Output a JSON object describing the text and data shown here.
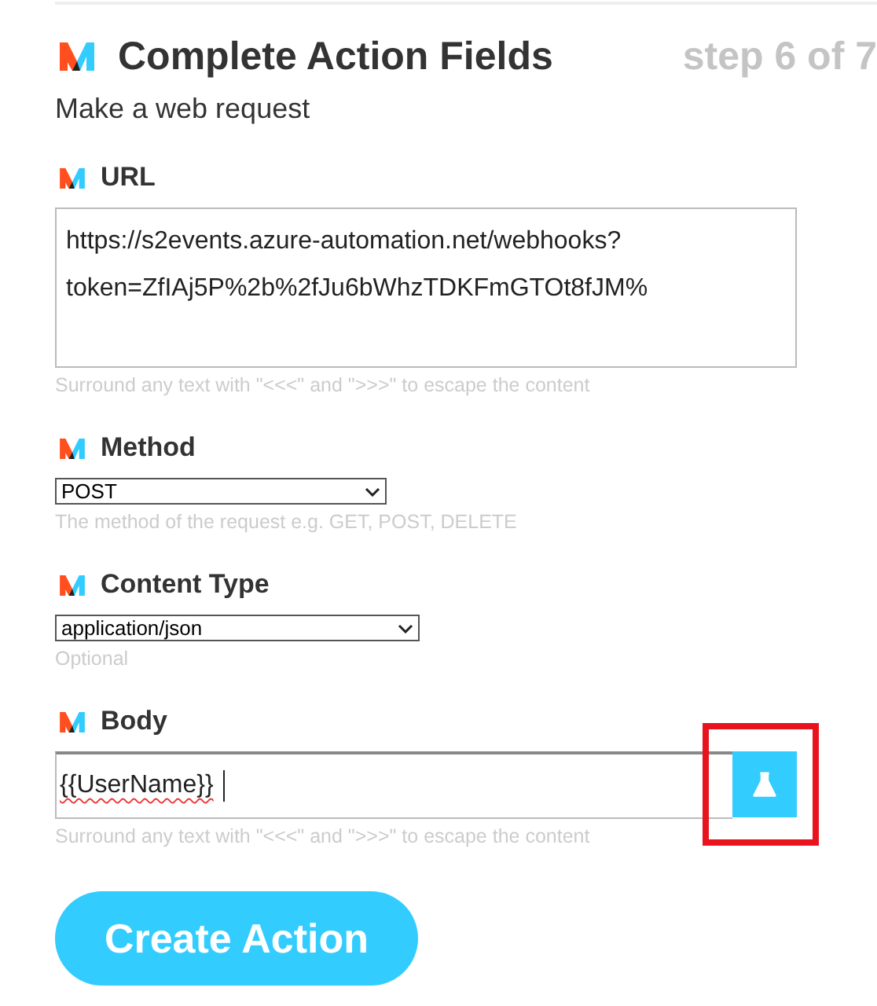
{
  "header": {
    "title": "Complete Action Fields",
    "step": "step 6 of 7",
    "subtitle": "Make a web request"
  },
  "fields": [
    {
      "kind": "textarea",
      "label": "URL",
      "value": "https://s2events.azure-automation.net/webhooks?token=ZfIAj5P%2b%2fJu6bWhzTDKFmGTOt8fJM%",
      "hint": "Surround any text with \"<<<\" and \">>>\" to escape the content"
    },
    {
      "kind": "select",
      "label": "Method",
      "value": "POST",
      "hint": "The method of the request e.g. GET, POST, DELETE"
    },
    {
      "kind": "select",
      "label": "Content Type",
      "value": "application/json",
      "hint": "Optional"
    },
    {
      "kind": "input",
      "label": "Body",
      "value": "{{UserName}}",
      "focused": true,
      "test_button_highlighted": true,
      "hint": "Surround any text with \"<<<\" and \">>>\" to escape the content"
    }
  ],
  "submit": {
    "label": "Create Action"
  }
}
